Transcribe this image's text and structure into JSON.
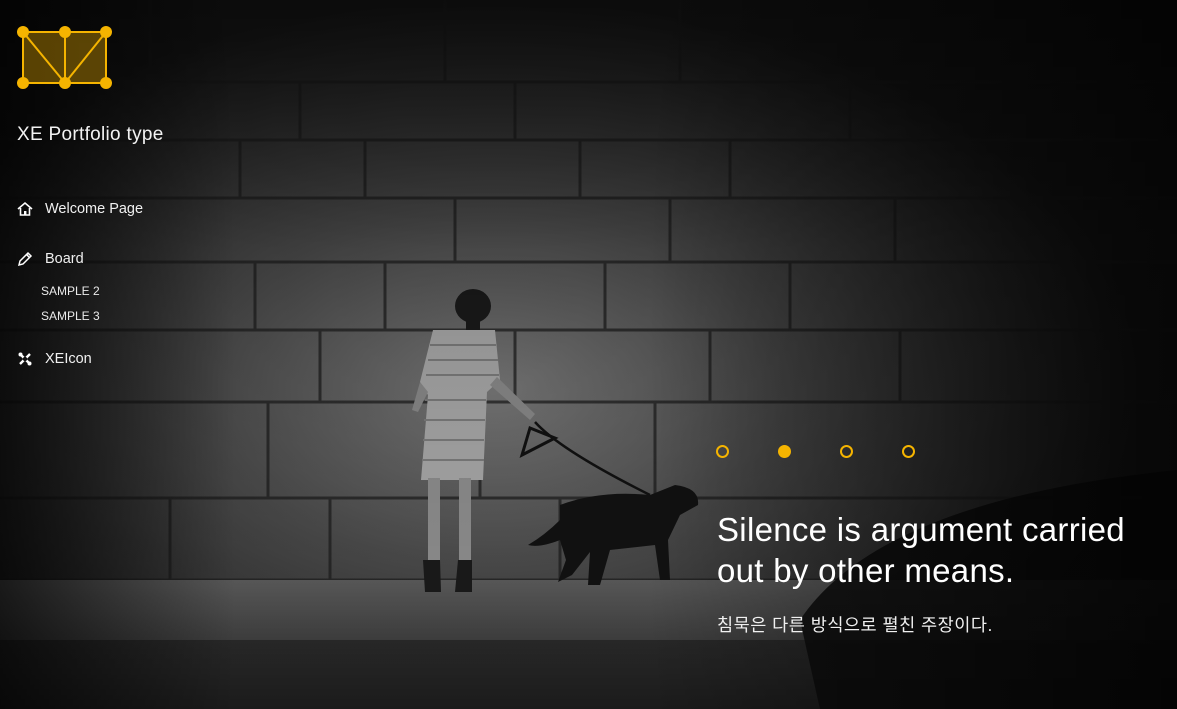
{
  "site": {
    "title": "XE Portfolio type",
    "brand_color": "#f5b400"
  },
  "nav": {
    "items": [
      {
        "label": "Welcome Page",
        "icon": "home-icon"
      },
      {
        "label": "Board",
        "icon": "pencil-icon",
        "children": [
          "SAMPLE 2",
          "SAMPLE 3"
        ]
      },
      {
        "label": "XEIcon",
        "icon": "xeicon-icon"
      }
    ]
  },
  "slider": {
    "slide_count": 4,
    "active_index": 1,
    "quote": "Silence is argument carried out by other means.",
    "quote_translation": "침묵은 다른 방식으로 펼친 주장이다."
  }
}
